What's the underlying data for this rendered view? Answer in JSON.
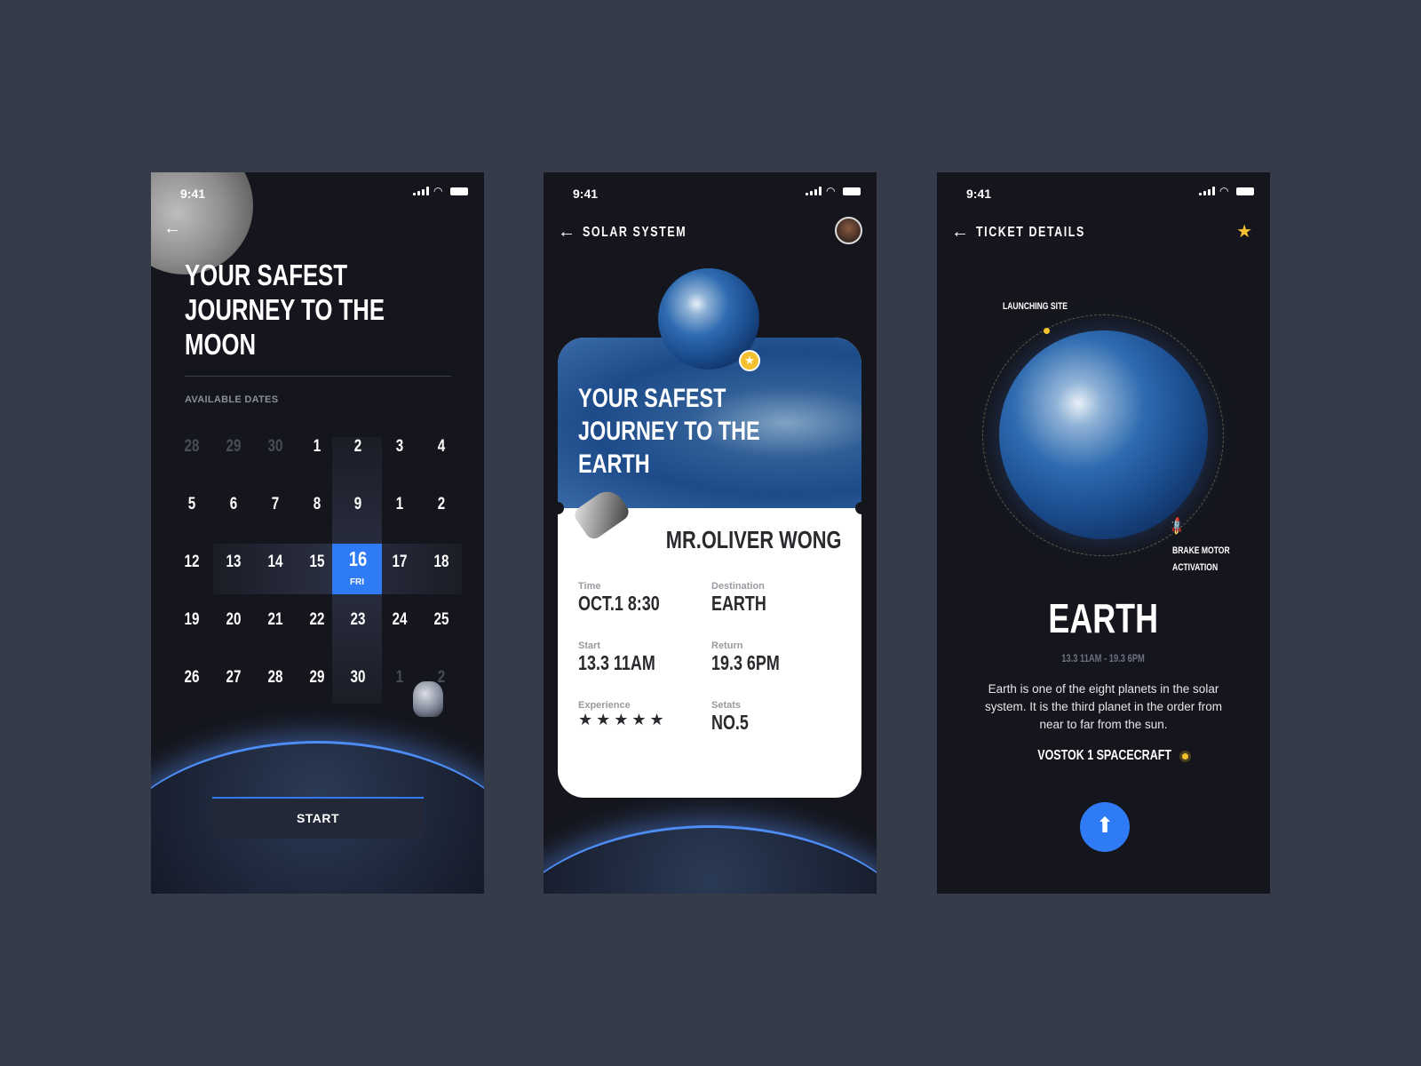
{
  "status_bar": {
    "time": "9:41"
  },
  "colors": {
    "background": "#363b4a",
    "screen": "#15161d",
    "accent": "#2f7bf5",
    "star": "#f5c12e"
  },
  "screen1": {
    "back_icon": "arrow-left-icon",
    "title_lines": [
      "YOUR SAFEST",
      "JOURNEY TO THE",
      "MOON"
    ],
    "available_dates_label": "AVAILABLE DATES",
    "calendar": [
      [
        {
          "d": "28",
          "dim": true
        },
        {
          "d": "29",
          "dim": true
        },
        {
          "d": "30",
          "dim": true
        },
        {
          "d": "1"
        },
        {
          "d": "2"
        },
        {
          "d": "3"
        },
        {
          "d": "4"
        }
      ],
      [
        {
          "d": "5"
        },
        {
          "d": "6"
        },
        {
          "d": "7"
        },
        {
          "d": "8"
        },
        {
          "d": "9"
        },
        {
          "d": "1"
        },
        {
          "d": "2"
        }
      ],
      [
        {
          "d": "12"
        },
        {
          "d": "13"
        },
        {
          "d": "14"
        },
        {
          "d": "15"
        },
        {
          "d": "16",
          "selected": true
        },
        {
          "d": "17"
        },
        {
          "d": "18"
        }
      ],
      [
        {
          "d": "19"
        },
        {
          "d": "20"
        },
        {
          "d": "21"
        },
        {
          "d": "22"
        },
        {
          "d": "23"
        },
        {
          "d": "24"
        },
        {
          "d": "25"
        }
      ],
      [
        {
          "d": "26"
        },
        {
          "d": "27"
        },
        {
          "d": "28"
        },
        {
          "d": "29"
        },
        {
          "d": "30"
        },
        {
          "d": "1",
          "dim": true
        },
        {
          "d": "2",
          "dim": true
        }
      ]
    ],
    "selected_weekday": "FRI",
    "start_button": "START"
  },
  "screen2": {
    "header_title": "SOLAR SYSTEM",
    "card_title_lines": [
      "YOUR SAFEST",
      "JOURNEY TO THE",
      "EARTH"
    ],
    "passenger": "MR.OLIVER WONG",
    "fields": {
      "time": {
        "label": "Time",
        "value": "OCT.1 8:30"
      },
      "destination": {
        "label": "Destination",
        "value": "EARTH"
      },
      "start": {
        "label": "Start",
        "value": "13.3 11AM"
      },
      "return": {
        "label": "Return",
        "value": "19.3 6PM"
      },
      "experience": {
        "label": "Experience",
        "rating": 5,
        "max": 5,
        "stars": "★★★★★"
      },
      "seats": {
        "label": "Setats",
        "value": "NO.5"
      }
    }
  },
  "screen3": {
    "header_title": "TICKET DETAILS",
    "launching_site": "LAUNCHING SITE",
    "brake_motor": [
      "BRAKE MOTOR",
      "ACTIVATION"
    ],
    "planet": "EARTH",
    "dates": "13.3 11AM - 19.3 6PM",
    "description": "Earth is one of the eight planets in the solar system. It is the third planet in the order from near to far from the sun.",
    "spacecraft": "VOSTOK 1 SPACECRAFT",
    "action_icon": "arrow-up-icon"
  }
}
